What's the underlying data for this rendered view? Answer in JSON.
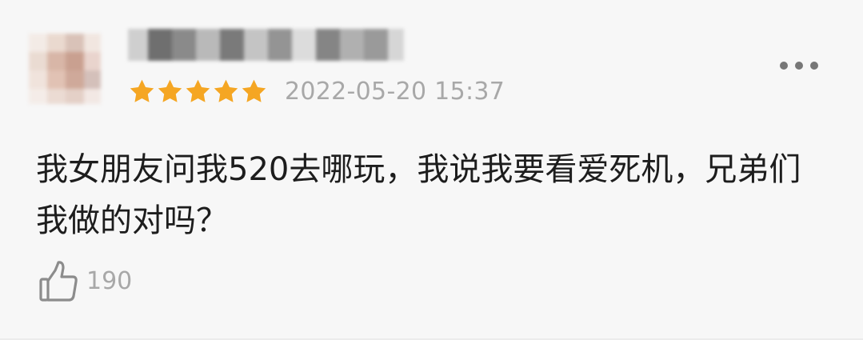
{
  "review": {
    "rating_stars": 5,
    "rating_max": 5,
    "star_color": "#f5a623",
    "timestamp": "2022-05-20 15:37",
    "more_icon": "more-horizontal-icon",
    "comment": "我女朋友问我520去哪玩，我说我要看爱死机，兄弟们我做的对吗？",
    "likes": {
      "icon": "thumbs-up-icon",
      "count": "190"
    }
  }
}
